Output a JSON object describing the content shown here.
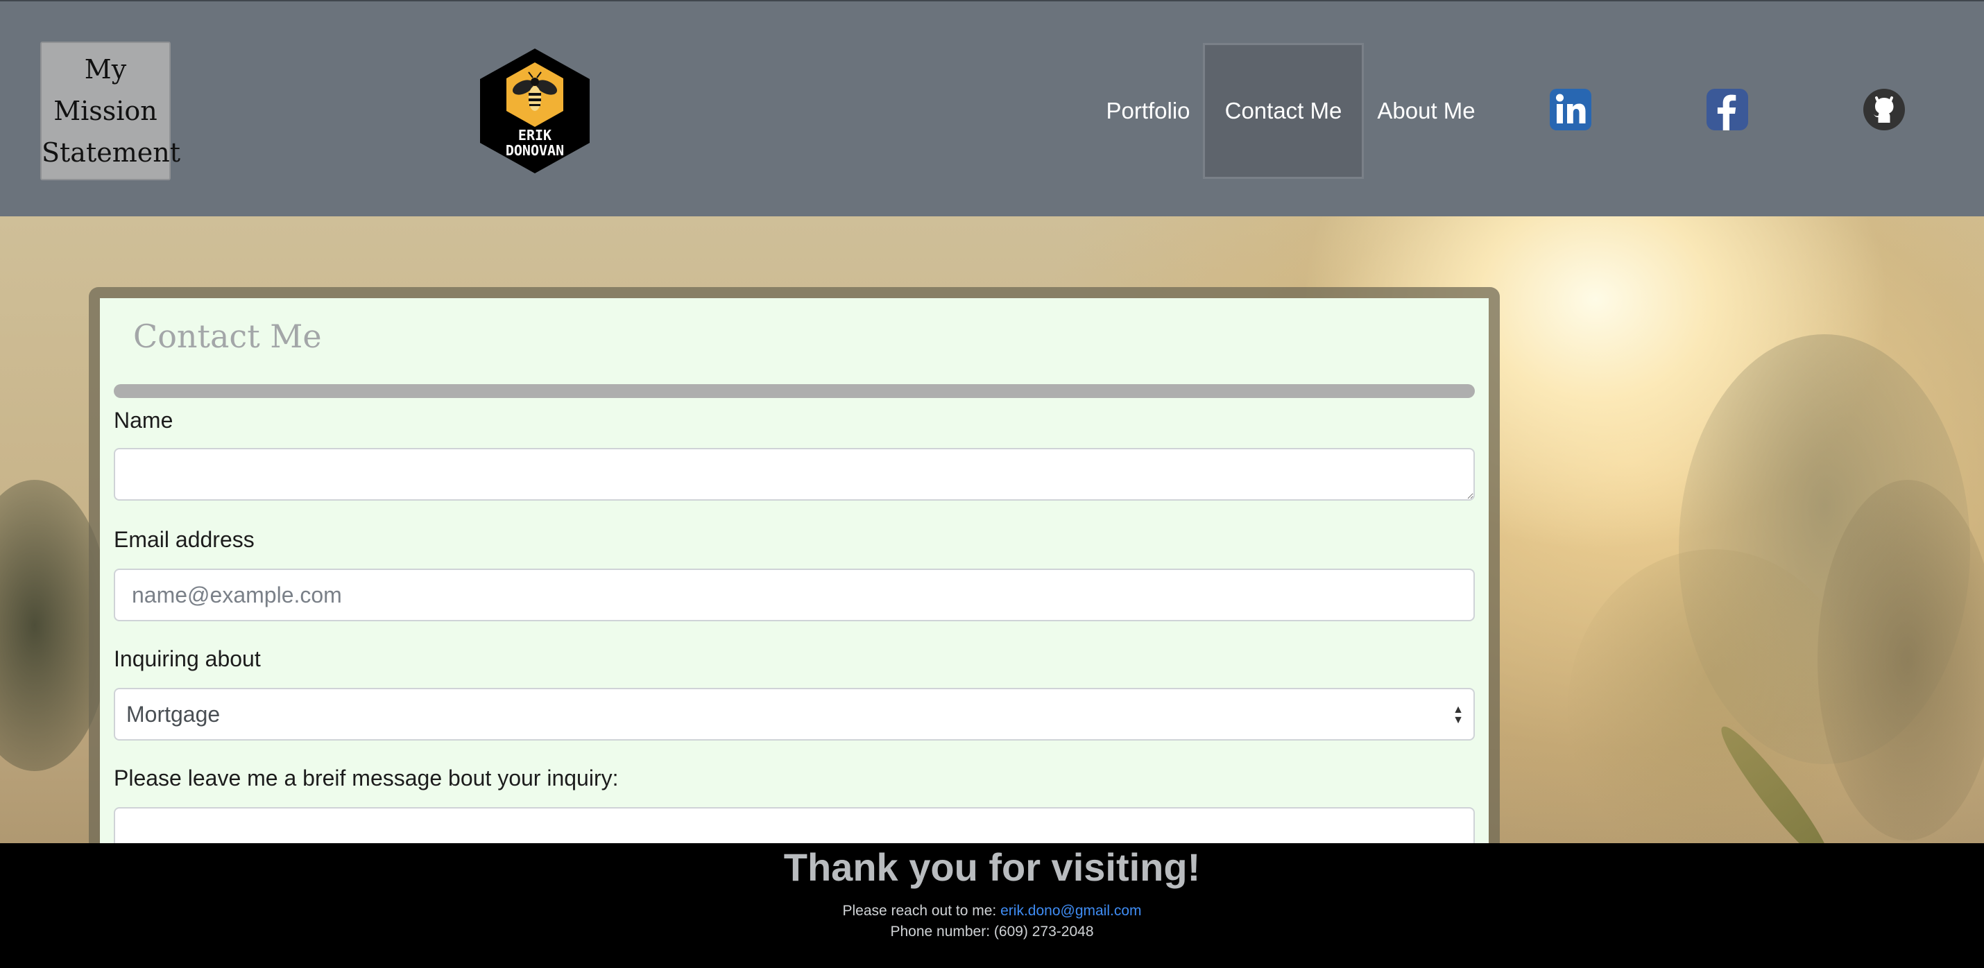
{
  "header": {
    "mission_label_lines": [
      "My",
      "Mission",
      "Statement"
    ],
    "logo_text_lines": [
      "ERIK",
      "DONOVAN"
    ],
    "nav": [
      {
        "label": "Portfolio",
        "active": false
      },
      {
        "label": "Contact Me",
        "active": true
      },
      {
        "label": "About Me",
        "active": false
      }
    ],
    "social": [
      {
        "icon": "linkedin-icon",
        "color": "#2867b2"
      },
      {
        "icon": "facebook-icon",
        "color": "#3b5998"
      },
      {
        "icon": "github-icon",
        "color": "#333333"
      }
    ]
  },
  "form": {
    "title": "Contact Me",
    "name_label": "Name",
    "name_value": "",
    "email_label": "Email address",
    "email_placeholder": "name@example.com",
    "inquiry_label": "Inquiring about",
    "inquiry_selected": "Mortgage",
    "message_label": "Please leave me a breif message bout your inquiry:",
    "message_value": ""
  },
  "footer": {
    "title": "Thank you for visiting!",
    "reach_prefix": "Please reach out to me: ",
    "email": "erik.dono@gmail.com",
    "phone_line": "Phone number: (609) 273-2048"
  },
  "colors": {
    "header_bg": "#6b737c",
    "panel_bg": "#eefcec",
    "footer_bg": "#000000",
    "link": "#3f8cf3",
    "logo_hex": "#f2b134"
  }
}
